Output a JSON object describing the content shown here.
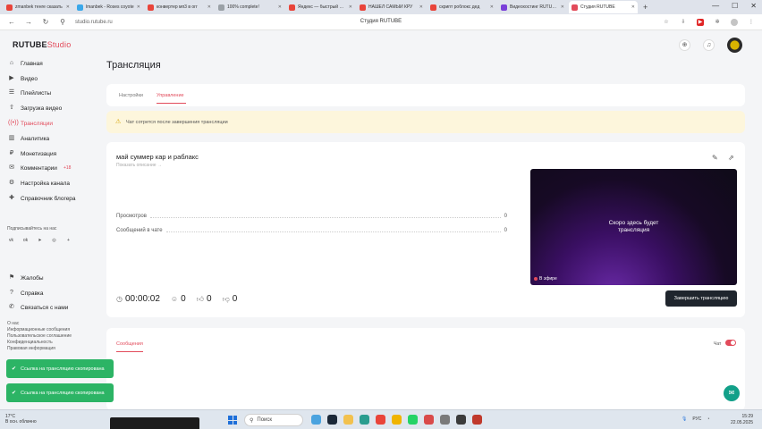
{
  "browser": {
    "tabs": [
      {
        "label": "zmanbek тенге сказать",
        "color": "#e9443a"
      },
      {
        "label": "lmanbek - Roses coyote",
        "color": "#3aa7e9"
      },
      {
        "label": "конвертер мп3 в огг",
        "color": "#e9443a"
      },
      {
        "label": "100% complete!",
        "color": "#9aa0a6"
      },
      {
        "label": "Яндекс — быстрый пои",
        "color": "#e9443a"
      },
      {
        "label": "НАШЁЛ САМЫЙ КРУ",
        "color": "#e9443a"
      },
      {
        "label": "скрипт роблокс дед",
        "color": "#e9443a"
      },
      {
        "label": "Видеохостинг RUTUBE",
        "color": "#7a3fd9"
      },
      {
        "label": "Студия RUTUBE",
        "color": "#e24b5b",
        "active": true
      }
    ],
    "url": "studio.rutube.ru",
    "page_title": "Студия RUTUBE"
  },
  "logo": {
    "main": "RUTUBE",
    "sub": "Studio"
  },
  "sidebar": {
    "items": [
      {
        "label": "Главная",
        "icon": "home-icon",
        "glyph": "⌂"
      },
      {
        "label": "Видео",
        "icon": "video-icon",
        "glyph": "▶"
      },
      {
        "label": "Плейлисты",
        "icon": "playlist-icon",
        "glyph": "☰"
      },
      {
        "label": "Загрузка видео",
        "icon": "upload-icon",
        "glyph": "⇧"
      },
      {
        "label": "Трансляции",
        "icon": "broadcast-icon",
        "glyph": "((•))",
        "active": true
      },
      {
        "label": "Аналитика",
        "icon": "analytics-icon",
        "glyph": "▥"
      },
      {
        "label": "Монетизация",
        "icon": "monetization-icon",
        "glyph": "₽"
      },
      {
        "label": "Комментарии",
        "icon": "comments-icon",
        "glyph": "✉",
        "badge": "+18"
      },
      {
        "label": "Настройка канала",
        "icon": "settings-icon",
        "glyph": "⚙"
      },
      {
        "label": "Справочник блогера",
        "icon": "book-icon",
        "glyph": "✚"
      }
    ],
    "subscribe_title": "Подписывайтесь на нас",
    "socials": [
      {
        "glyph": "vk",
        "icon": "vk-icon"
      },
      {
        "glyph": "ok",
        "icon": "ok-icon"
      },
      {
        "glyph": "➤",
        "icon": "telegram-icon"
      },
      {
        "glyph": "◎",
        "icon": "viber-icon"
      },
      {
        "glyph": "+",
        "icon": "more-socials-icon"
      }
    ],
    "bottom_items": [
      {
        "label": "Жалобы",
        "icon": "flag-icon",
        "glyph": "⚑"
      },
      {
        "label": "Справка",
        "icon": "help-icon",
        "glyph": "?"
      },
      {
        "label": "Связаться с нами",
        "icon": "contact-icon",
        "glyph": "✆"
      }
    ],
    "footer_links": [
      "О нас",
      "Информационные сообщения",
      "Пользовательское соглашение",
      "Конфиденциальность",
      "Правовая информация"
    ]
  },
  "page": {
    "title": "Трансляция",
    "tabs": {
      "settings": "Настройки",
      "control": "Управление"
    },
    "warning": "Чат сотрется после завершения трансляции",
    "stream_title": "май суммер кар и раблакс",
    "show_description": "Показать описание →",
    "stats": [
      {
        "label": "Просмотров",
        "value": "0"
      },
      {
        "label": "Сообщений в чате",
        "value": "0"
      }
    ],
    "preview_text_line1": "Скоро здесь будет",
    "preview_text_line2": "трансляция",
    "live_label": "В эфире",
    "timer": "00:00:02",
    "viewers": "0",
    "likes": "0",
    "dislikes": "0",
    "end_button": "Завершить трансляцию",
    "chat_tab": "Сообщения",
    "chat_label": "Чат"
  },
  "toasts": [
    "Ссылка на трансляцию скопирована",
    "Ссылка на трансляцию скопирована"
  ],
  "taskbar": {
    "weather_temp": "17°C",
    "weather_desc": "В осн. облачно",
    "search": "Поиск",
    "lang": "РУС",
    "time": "15:29",
    "date": "22.05.2025"
  }
}
